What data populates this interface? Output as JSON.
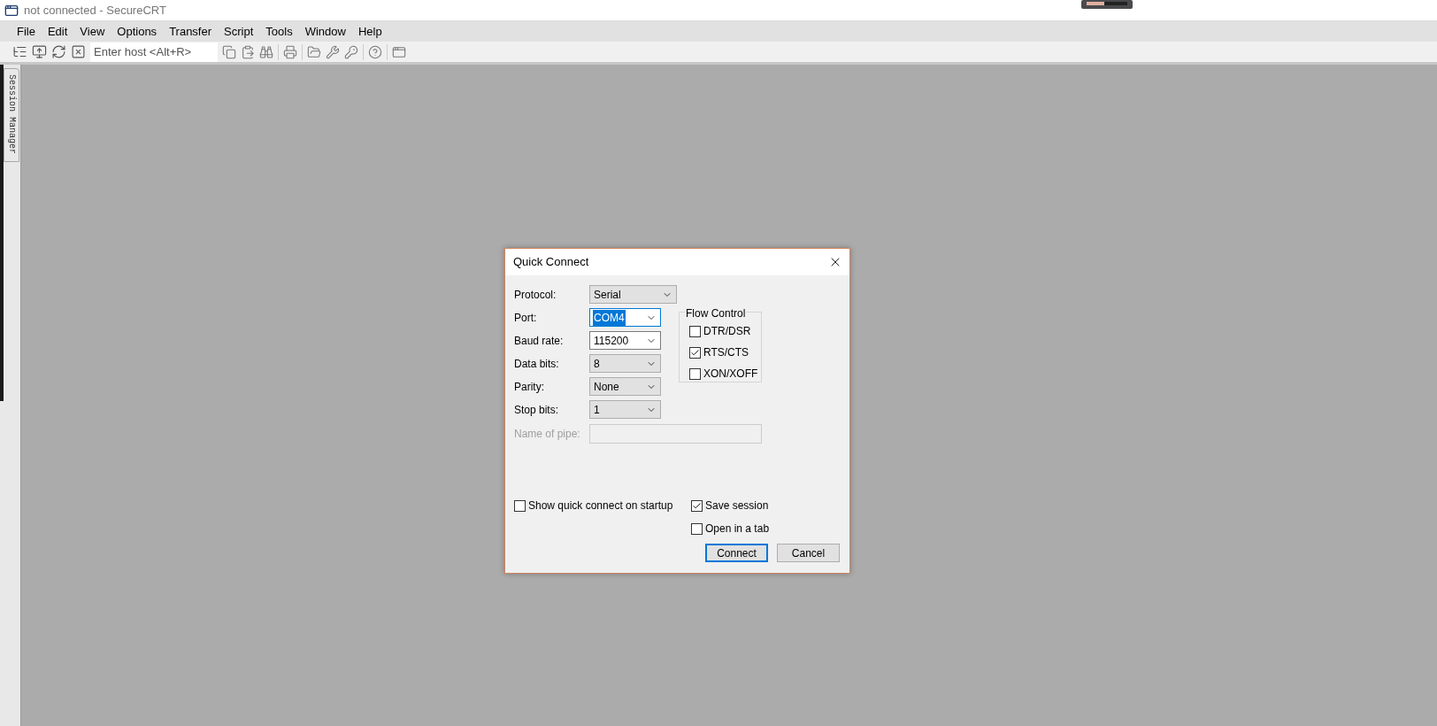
{
  "window": {
    "title": "not connected - SecureCRT"
  },
  "menu": [
    {
      "label": "File"
    },
    {
      "label": "Edit"
    },
    {
      "label": "View"
    },
    {
      "label": "Options"
    },
    {
      "label": "Transfer"
    },
    {
      "label": "Script"
    },
    {
      "label": "Tools"
    },
    {
      "label": "Window"
    },
    {
      "label": "Help"
    }
  ],
  "toolbar": {
    "host_field": {
      "placeholder": "Enter host <Alt+R>"
    }
  },
  "side_tab": {
    "label": "Session Manager"
  },
  "dialog": {
    "title": "Quick Connect",
    "fields": [
      {
        "label": "Protocol:",
        "value": "Serial",
        "kind": "dropdown",
        "focused": false,
        "disabled": false
      },
      {
        "label": "Port:",
        "value": "COM4",
        "kind": "combo",
        "focused": true,
        "disabled": false
      },
      {
        "label": "Baud rate:",
        "value": "115200",
        "kind": "combo",
        "focused": false,
        "disabled": false
      },
      {
        "label": "Data bits:",
        "value": "8",
        "kind": "dropdown",
        "focused": false,
        "disabled": false
      },
      {
        "label": "Parity:",
        "value": "None",
        "kind": "dropdown",
        "focused": false,
        "disabled": false
      },
      {
        "label": "Stop bits:",
        "value": "1",
        "kind": "dropdown",
        "focused": false,
        "disabled": false
      },
      {
        "label": "Name of pipe:",
        "kind": "text",
        "focused": false,
        "disabled": true
      }
    ],
    "flow_control": {
      "title": "Flow Control",
      "options": [
        {
          "label": "DTR/DSR",
          "checked": false
        },
        {
          "label": "RTS/CTS",
          "checked": true
        },
        {
          "label": "XON/XOFF",
          "checked": false
        }
      ]
    },
    "startup_option": {
      "label": "Show quick connect on startup",
      "checked": false
    },
    "session_options": [
      {
        "label": "Save session",
        "checked": true
      },
      {
        "label": "Open in a tab",
        "checked": false
      }
    ],
    "buttons": [
      {
        "label": "Connect",
        "default": true
      },
      {
        "label": "Cancel",
        "default": false
      }
    ]
  }
}
